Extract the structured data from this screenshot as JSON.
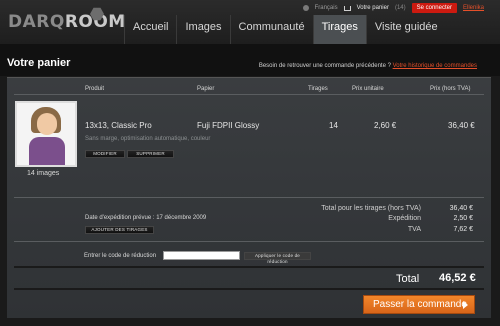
{
  "brand": {
    "dark": "DARQ",
    "light": "ROOM"
  },
  "nav": [
    {
      "label": "Accueil"
    },
    {
      "label": "Images"
    },
    {
      "label": "Communauté"
    },
    {
      "label": "Tirages"
    },
    {
      "label": "Visite guidée"
    }
  ],
  "util": {
    "lang": "Français",
    "cart_label": "Votre panier",
    "cart_count": "(14)",
    "connect": "Se connecter",
    "other_lang": "Ellenika"
  },
  "page": {
    "title": "Votre panier",
    "history_question": "Besoin de retrouver une commande précédente ?",
    "history_link": "Votre historique de commandes"
  },
  "table": {
    "headers": {
      "product": "Produit",
      "paper": "Papier",
      "prints": "Tirages",
      "unit_price": "Prix unitaire",
      "price": "Prix (hors TVA)"
    },
    "row": {
      "product": "13x13, Classic Pro",
      "paper": "Fuji FDPII Glossy",
      "prints": "14",
      "unit_price": "2,60 €",
      "price": "36,40 €",
      "options": "Sans marge, optimisation automatique, couleur",
      "images_count": "14 images",
      "modify": "MODIFIER",
      "delete": "SUPPRIMER"
    }
  },
  "summary": {
    "subtotal_label": "Total pour les tirages (hors TVA)",
    "subtotal": "36,40 €",
    "shipping_label": "Expédition",
    "shipping": "2,50 €",
    "vat_label": "TVA",
    "vat": "7,62 €",
    "ship_date": "Date d'expédition prévue : 17 décembre 2009",
    "add_prints": "AJOUTER DES TIRAGES"
  },
  "promo": {
    "label": "Entrer le code de réduction",
    "value": "",
    "apply": "Appliquer le code de réduction"
  },
  "total": {
    "label": "Total",
    "value": "46,52 €"
  },
  "checkout": "Passer la commande"
}
